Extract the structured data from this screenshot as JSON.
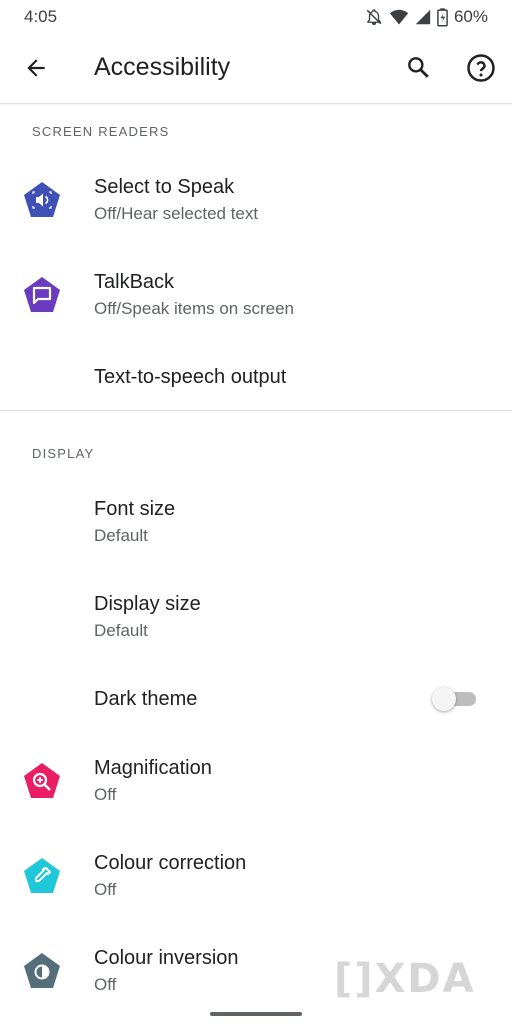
{
  "status_bar": {
    "time": "4:05",
    "battery": "60%",
    "icons": [
      "notifications-off-icon",
      "wifi-icon",
      "signal-icon",
      "battery-icon"
    ]
  },
  "app_bar": {
    "title": "Accessibility",
    "icons": [
      "back-arrow-icon",
      "search-icon",
      "help-icon"
    ]
  },
  "sections": {
    "screen_readers": {
      "header": "SCREEN READERS",
      "items": [
        {
          "title": "Select to Speak",
          "summary": "Off/Hear selected text",
          "icon": "select-to-speak-icon",
          "color": "#3f51b5"
        },
        {
          "title": "TalkBack",
          "summary": "Off/Speak items on screen",
          "icon": "talkback-icon",
          "color": "#6a3bbf"
        },
        {
          "title": "Text-to-speech output"
        }
      ]
    },
    "display": {
      "header": "DISPLAY",
      "items": [
        {
          "title": "Font size",
          "summary": "Default"
        },
        {
          "title": "Display size",
          "summary": "Default"
        },
        {
          "title": "Dark theme",
          "toggle_on": false
        },
        {
          "title": "Magnification",
          "summary": "Off",
          "icon": "magnification-icon",
          "color": "#e91e63"
        },
        {
          "title": "Colour correction",
          "summary": "Off",
          "icon": "colour-correction-icon",
          "color": "#1ec8d8"
        },
        {
          "title": "Colour inversion",
          "summary": "Off",
          "icon": "colour-inversion-icon",
          "color": "#546e7a"
        }
      ]
    }
  },
  "watermark": "[]XDA"
}
